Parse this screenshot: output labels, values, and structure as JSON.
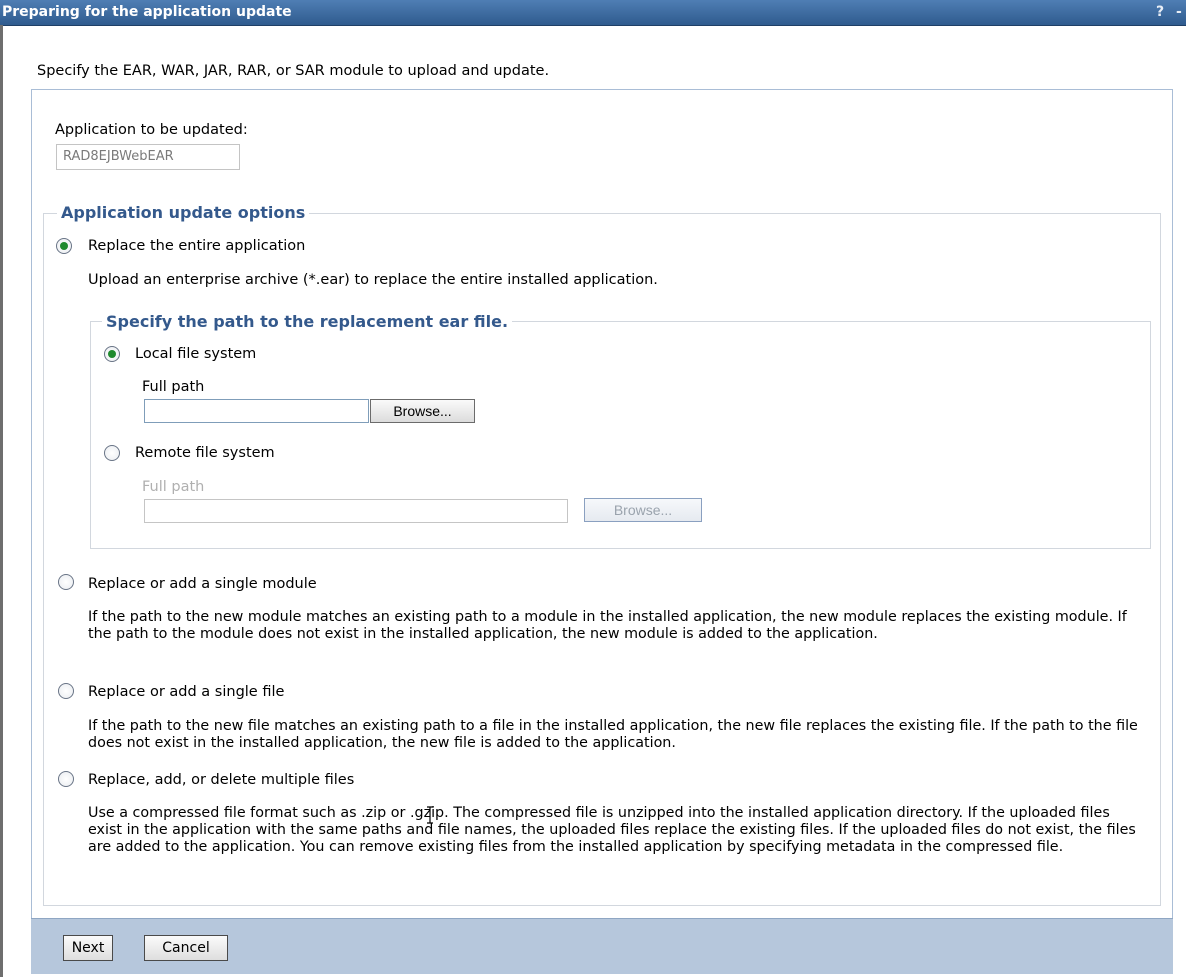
{
  "window": {
    "title": "Preparing for the application update",
    "help_glyph": "?",
    "extra_glyph": "-"
  },
  "instruction": "Specify the EAR, WAR, JAR, RAR, or SAR module to upload and update.",
  "application": {
    "label": "Application to be updated:",
    "value": "RAD8EJBWebEAR"
  },
  "update_options": {
    "legend": "Application update options",
    "replace_entire": {
      "label": "Replace the entire application",
      "selected": true,
      "description": "Upload an enterprise archive (*.ear) to replace the entire installed application."
    },
    "path_section": {
      "legend": "Specify the path to the replacement ear file.",
      "local": {
        "label": "Local file system",
        "selected": true,
        "field_label": "Full path",
        "value": "",
        "browse_label": "Browse..."
      },
      "remote": {
        "label": "Remote file system",
        "selected": false,
        "field_label": "Full path",
        "value": "",
        "browse_label": "Browse..."
      }
    },
    "single_module": {
      "label": "Replace or add a single module",
      "selected": false,
      "description": "If the path to the new module matches an existing path to a module in the installed application, the new module replaces the existing module. If the path to the module does not exist in the installed application, the new module is added to the application."
    },
    "single_file": {
      "label": "Replace or add a single file",
      "selected": false,
      "description": "If the path to the new file matches an existing path to a file in the installed application, the new file replaces the existing file. If the path to the file does not exist in the installed application, the new file is added to the application."
    },
    "multiple_files": {
      "label": "Replace, add, or delete multiple files",
      "selected": false,
      "description": "Use a compressed file format such as .zip or .gzip. The compressed file is unzipped into the installed application directory. If the uploaded files exist in the application with the same paths and file names, the uploaded files replace the existing files. If the uploaded files do not exist, the files are added to the application. You can remove existing files from the installed application by specifying metadata in the compressed file."
    }
  },
  "footer": {
    "next_label": "Next",
    "cancel_label": "Cancel"
  },
  "colors": {
    "title_bar": "#2f5b8e",
    "legend_text": "#34598c",
    "footer_bg": "#b6c7dc",
    "radio_selected": "#1f8a2e"
  }
}
